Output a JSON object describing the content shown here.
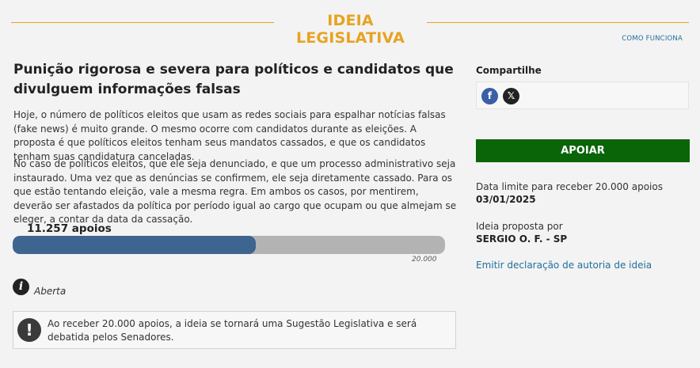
{
  "header": {
    "title": "IDEIA LEGISLATIVA",
    "how_it_works": "COMO FUNCIONA",
    "accent_color": "#e8a321"
  },
  "idea": {
    "title": "Punição rigorosa e severa para políticos e candidatos que divulguem informações falsas",
    "paragraphs": [
      "Hoje, o número de políticos eleitos que usam as redes sociais para espalhar notícias falsas (fake news) é muito grande. O mesmo ocorre com candidatos durante as eleições. A proposta é que políticos eleitos tenham seus mandatos cassados, e que os candidatos tenham suas candidatura canceladas.",
      "No caso de políticos eleitos, que ele seja denunciado, e que um processo administrativo seja instaurado. Uma vez que as denúncias se confirmem, ele seja diretamente cassado. Para os que estão tentando eleição, vale a mesma regra. Em ambos os casos, por mentirem, deverão ser afastados da política por período igual ao cargo que ocupam ou que almejam se eleger, a contar da data da cassação."
    ]
  },
  "progress": {
    "count_label": "11.257 apoios",
    "goal_label": "20.000",
    "current": 11257,
    "goal": 20000,
    "fill_color": "#3e6490",
    "track_color": "#b3b3b3"
  },
  "status": {
    "icon": "info-icon",
    "label": "Aberta"
  },
  "notice": {
    "icon": "exclamation-icon",
    "text": "Ao receber 20.000 apoios, a ideia se tornará uma Sugestão Legislativa e será debatida pelos Senadores."
  },
  "sidebar": {
    "share_label": "Compartilhe",
    "share_icons": [
      "facebook-icon",
      "x-icon"
    ],
    "support_button": "APOIAR",
    "support_color": "#0a6408",
    "deadline_label": "Data limite para receber 20.000 apoios",
    "deadline_value": "03/01/2025",
    "author_label": "Ideia proposta por",
    "author_value": "SERGIO O. F. - SP",
    "authorship_link": "Emitir declaração de autoria de ideia"
  }
}
